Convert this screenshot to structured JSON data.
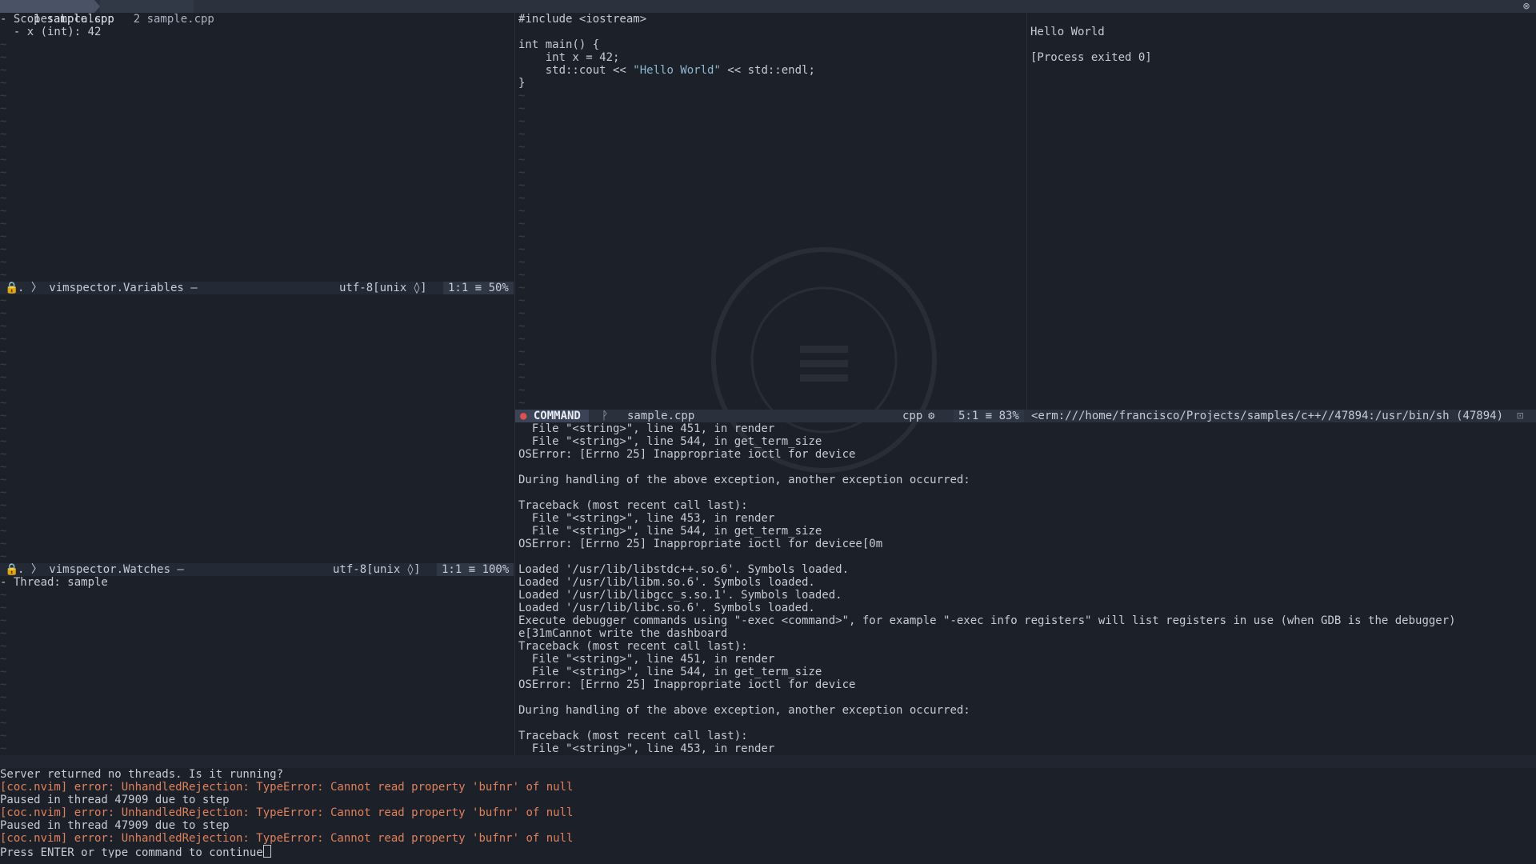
{
  "tabline": {
    "tabs": [
      {
        "label": "1 sample.cpp"
      },
      {
        "label": "2 sample.cpp"
      }
    ],
    "close_glyph": "⊗"
  },
  "variables_pane": {
    "lines": [
      "- Scope: Locals",
      "  - x (int): 42"
    ],
    "status": {
      "lock": "🔒",
      "path": ". 〉 vimspector.Variables –",
      "encoding": "utf-8[unix ◊]",
      "position": "1:1 ≡ 50%"
    }
  },
  "watches_pane": {
    "status": {
      "lock": "🔒",
      "path": ". 〉 vimspector.Watches –",
      "encoding": "utf-8[unix ◊]",
      "position": "1:1 ≡ 100%"
    }
  },
  "stack_pane": {
    "lines": [
      "- Thread: sample"
    ]
  },
  "code_pane": {
    "lines": [
      "#include <iostream>",
      "",
      "int main() {",
      "    int x = 42;",
      "    std::cout << \"Hello World\" << std::endl;",
      "}"
    ],
    "status": {
      "mode": "COMMAND",
      "branch_icon": "ᚹ",
      "filename": "sample.cpp",
      "filetype": "cpp",
      "position": "5:1 ≡ 83%"
    }
  },
  "terminal_pane": {
    "lines": [
      "",
      "Hello World",
      "",
      "[Process exited 0]"
    ],
    "status_title": "<erm:///home/francisco/Projects/samples/c++//47894:/usr/bin/sh (47894)"
  },
  "console_pane": {
    "lines": [
      "  File \"<string>\", line 451, in render",
      "  File \"<string>\", line 544, in get_term_size",
      "OSError: [Errno 25] Inappropriate ioctl for device",
      "",
      "During handling of the above exception, another exception occurred:",
      "",
      "Traceback (most recent call last):",
      "  File \"<string>\", line 453, in render",
      "  File \"<string>\", line 544, in get_term_size",
      "OSError: [Errno 25] Inappropriate ioctl for devicee[0m",
      "",
      "Loaded '/usr/lib/libstdc++.so.6'. Symbols loaded.",
      "Loaded '/usr/lib/libm.so.6'. Symbols loaded.",
      "Loaded '/usr/lib/libgcc_s.so.1'. Symbols loaded.",
      "Loaded '/usr/lib/libc.so.6'. Symbols loaded.",
      "Execute debugger commands using \"-exec <command>\", for example \"-exec info registers\" will list registers in use (when GDB is the debugger)",
      "e[31mCannot write the dashboard",
      "Traceback (most recent call last):",
      "  File \"<string>\", line 451, in render",
      "  File \"<string>\", line 544, in get_term_size",
      "OSError: [Errno 25] Inappropriate ioctl for device",
      "",
      "During handling of the above exception, another exception occurred:",
      "",
      "Traceback (most recent call last):",
      "  File \"<string>\", line 453, in render"
    ]
  },
  "messages": {
    "lines": [
      {
        "text": "Server returned no threads. Is it running?",
        "kind": "normal"
      },
      {
        "text": "[coc.nvim] error: UnhandledRejection: TypeError: Cannot read property 'bufnr' of null",
        "kind": "error"
      },
      {
        "text": "Paused in thread 47909 due to step",
        "kind": "normal"
      },
      {
        "text": "[coc.nvim] error: UnhandledRejection: TypeError: Cannot read property 'bufnr' of null",
        "kind": "error"
      },
      {
        "text": "Paused in thread 47909 due to step",
        "kind": "normal"
      },
      {
        "text": "[coc.nvim] error: UnhandledRejection: TypeError: Cannot read property 'bufnr' of null",
        "kind": "error"
      }
    ],
    "prompt": "Press ENTER or type command to continue"
  },
  "empty_line_marker": "~",
  "colors": {
    "background": "#1b2029",
    "error": "#e0805a",
    "mode_dot": "#e0504c",
    "string": "#8fb6cf"
  }
}
